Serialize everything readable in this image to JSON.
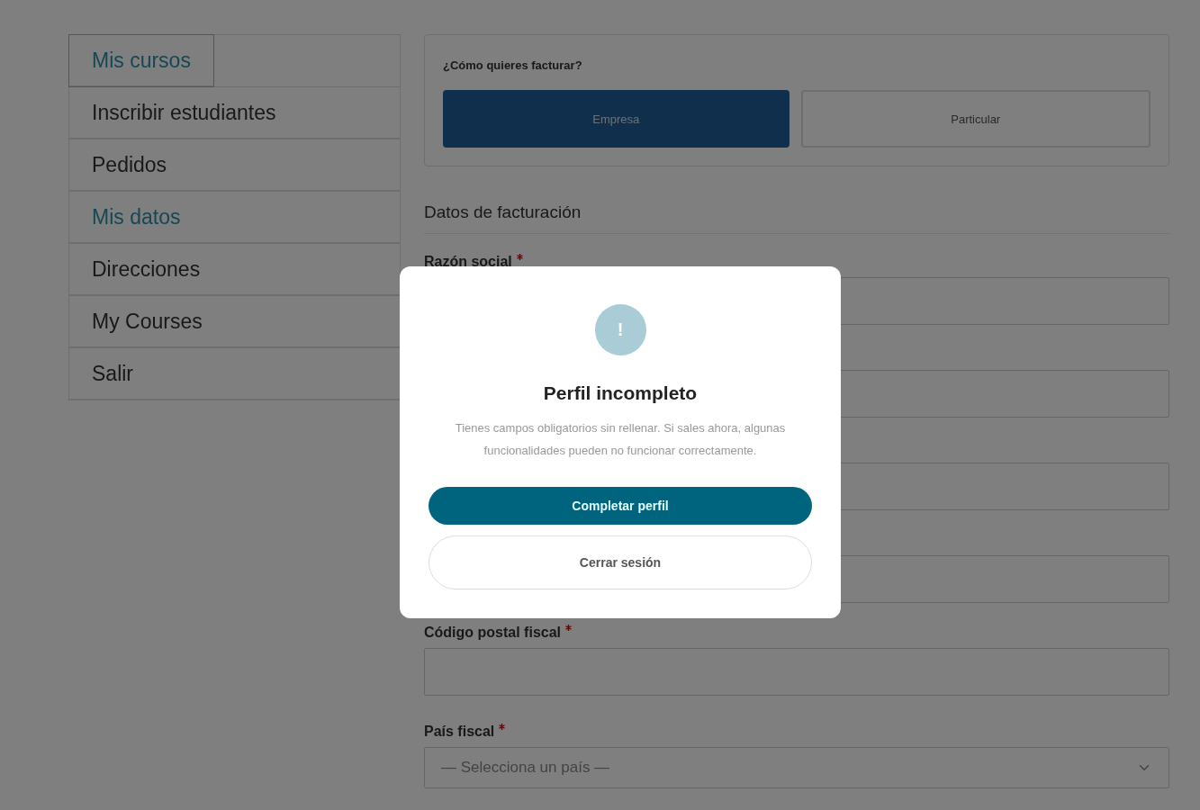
{
  "sidebar": {
    "items": [
      {
        "label": "Mis cursos",
        "selected": true,
        "focused": true
      },
      {
        "label": "Inscribir estudiantes",
        "selected": false,
        "focused": false
      },
      {
        "label": "Pedidos",
        "selected": false,
        "focused": false
      },
      {
        "label": "Mis datos",
        "selected": true,
        "focused": false
      },
      {
        "label": "Direcciones",
        "selected": false,
        "focused": false
      },
      {
        "label": "My Courses",
        "selected": false,
        "focused": false
      },
      {
        "label": "Salir",
        "selected": false,
        "focused": false
      }
    ]
  },
  "billing_type": {
    "question": "¿Cómo quieres facturar?",
    "options": [
      {
        "label": "Empresa",
        "selected": true
      },
      {
        "label": "Particular",
        "selected": false
      }
    ]
  },
  "billing_data": {
    "title": "Datos de facturación",
    "fields": [
      {
        "kind": "input",
        "label": "Razón social",
        "required": true
      },
      {
        "kind": "input"
      },
      {
        "kind": "input"
      },
      {
        "kind": "input"
      },
      {
        "kind": "input",
        "label": "Código postal fiscal",
        "required": true
      },
      {
        "kind": "select",
        "label": "País fiscal",
        "required": true,
        "placeholder": "— Selecciona un país —"
      }
    ]
  },
  "modal": {
    "icon": "!",
    "title": "Perfil incompleto",
    "message": "Tienes campos obligatorios sin rellenar. Si sales ahora, algunas funcionalidades pueden no funcionar correctamente.",
    "buttons": [
      {
        "kind": "primary",
        "label": "Completar perfil"
      },
      {
        "kind": "secondary",
        "label": "Cerrar sesión"
      }
    ]
  }
}
